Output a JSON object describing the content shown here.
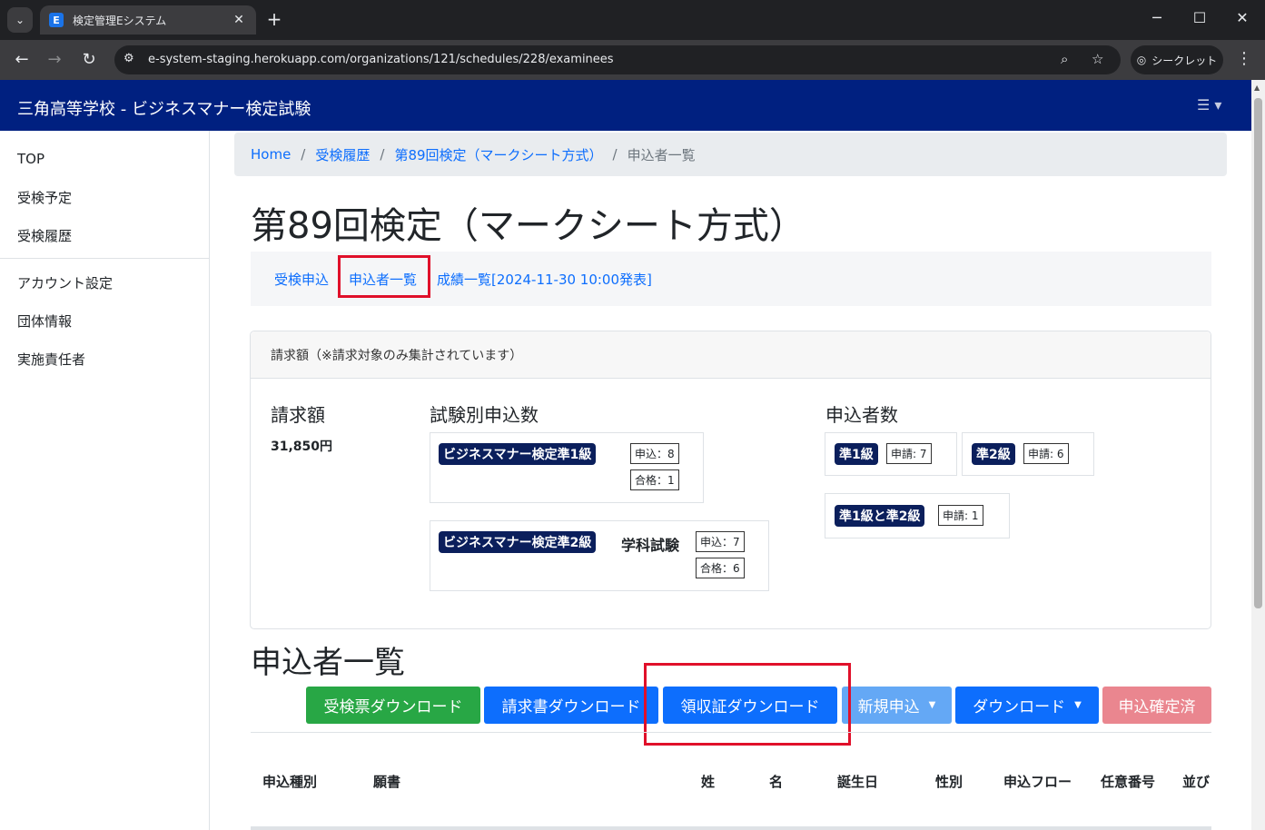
{
  "browser": {
    "tab_title": "検定管理Eシステム",
    "favicon_letter": "E",
    "url": "e-system-staging.herokuapp.com/organizations/121/schedules/228/examinees",
    "incognito_label": "シークレット"
  },
  "app": {
    "title": "三角高等学校 - ビジネスマナー検定試験"
  },
  "sidebar": {
    "items": [
      {
        "label": "TOP"
      },
      {
        "label": "受検予定"
      },
      {
        "label": "受検履歴"
      },
      {
        "label": "アカウント設定"
      },
      {
        "label": "団体情報"
      },
      {
        "label": "実施責任者"
      }
    ]
  },
  "breadcrumb": {
    "items": [
      "Home",
      "受検履歴",
      "第89回検定（マークシート方式）"
    ],
    "current": "申込者一覧"
  },
  "page": {
    "title": "第89回検定（マークシート方式）"
  },
  "subnav": {
    "items": [
      "受検申込",
      "申込者一覧",
      "成績一覧[2024-11-30 10:00発表]"
    ]
  },
  "billing": {
    "header": "請求額（※請求対象のみ集計されています）",
    "amount_heading": "請求額",
    "amount": "31,850円",
    "exam_heading": "試験別申込数",
    "exams": [
      {
        "badge": "ビジネスマナー検定準1級",
        "label": "",
        "applied": "申込：8",
        "passed": "合格：1"
      },
      {
        "badge": "ビジネスマナー検定準2級",
        "label": "学科試験",
        "applied": "申込：7",
        "passed": "合格：6"
      }
    ],
    "applicants_heading": "申込者数",
    "applicants": [
      {
        "badge": "準1級",
        "count": "申請: 7"
      },
      {
        "badge": "準2級",
        "count": "申請: 6"
      },
      {
        "badge": "準1級と準2級",
        "count": "申請: 1"
      }
    ]
  },
  "list": {
    "title": "申込者一覧",
    "buttons": {
      "ticket": "受検票ダウンロード",
      "invoice": "請求書ダウンロード",
      "receipt": "領収証ダウンロード",
      "new": "新規申込",
      "download": "ダウンロード",
      "confirmed": "申込確定済"
    },
    "columns": [
      "申込種別",
      "願書",
      "姓",
      "名",
      "誕生日",
      "性別",
      "申込フロー",
      "任意番号",
      "並び"
    ]
  }
}
